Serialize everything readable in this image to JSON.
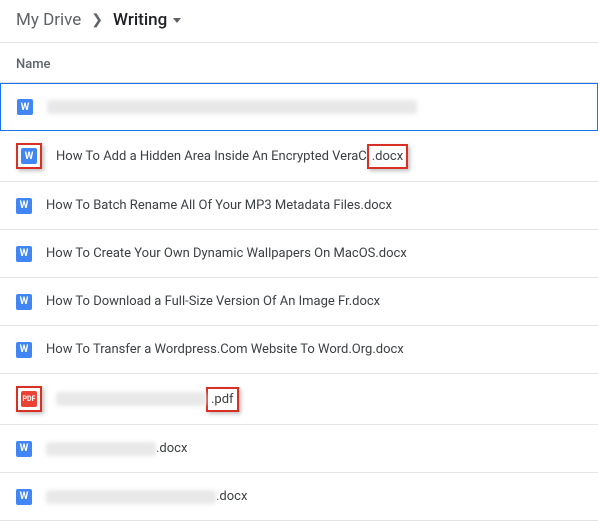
{
  "breadcrumb": {
    "root": "My Drive",
    "current": "Writing"
  },
  "columns": {
    "name": "Name"
  },
  "files": [
    {
      "type": "docx",
      "name": "",
      "selected": true,
      "blurred": true,
      "blurWidth": 370,
      "iconBoxed": false,
      "extBoxed": false
    },
    {
      "type": "docx",
      "namePrefix": "How To Add a Hidden Area Inside An Encrypted VeraC",
      "ext": ".docx",
      "iconBoxed": true,
      "extBoxed": true
    },
    {
      "type": "docx",
      "name": "How To Batch Rename All Of Your MP3 Metadata Files.docx"
    },
    {
      "type": "docx",
      "name": "How To Create Your Own Dynamic Wallpapers On MacOS.docx"
    },
    {
      "type": "docx",
      "name": "How To Download a Full-Size Version Of An Image Fr.docx"
    },
    {
      "type": "docx",
      "name": "How To Transfer a Wordpress.Com Website To Word.Org.docx"
    },
    {
      "type": "pdf",
      "blurred": true,
      "blurWidth": 150,
      "ext": ".pdf",
      "iconBoxed": true,
      "extBoxed": true
    },
    {
      "type": "docx",
      "blurred": true,
      "blurWidth": 110,
      "ext": ".docx"
    },
    {
      "type": "docx",
      "blurred": true,
      "blurWidth": 170,
      "ext": ".docx"
    }
  ]
}
